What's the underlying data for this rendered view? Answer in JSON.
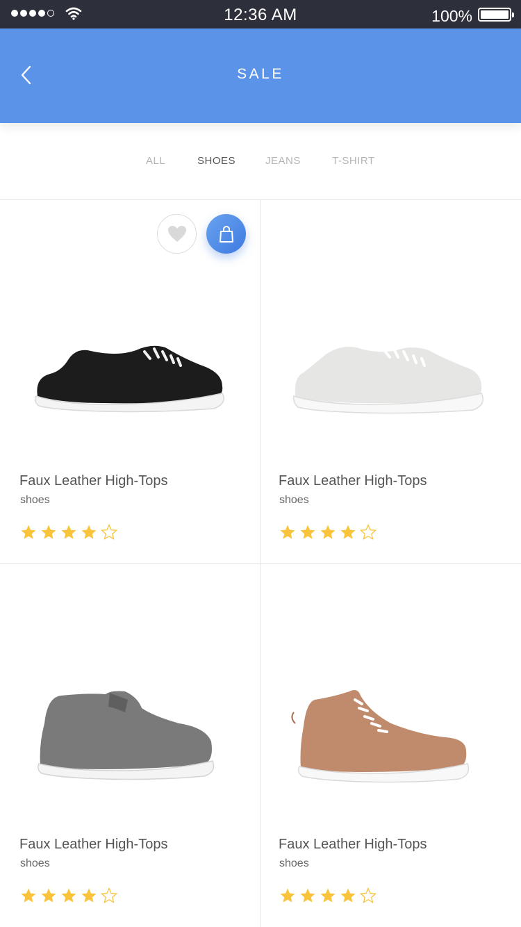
{
  "status_bar": {
    "time": "12:36 AM",
    "battery": "100%"
  },
  "header": {
    "title": "SALE"
  },
  "tabs": [
    {
      "label": "ALL",
      "active": false
    },
    {
      "label": "SHOES",
      "active": true
    },
    {
      "label": "JEANS",
      "active": false
    },
    {
      "label": "T-SHIRT",
      "active": false
    }
  ],
  "products": [
    {
      "name": "Faux Leather High-Tops",
      "category": "shoes",
      "rating": 4,
      "max_rating": 5,
      "color": "#1c1c1c"
    },
    {
      "name": "Faux Leather High-Tops",
      "category": "shoes",
      "rating": 4,
      "max_rating": 5,
      "color": "#e6e6e4"
    },
    {
      "name": "Faux Leather High-Tops",
      "category": "shoes",
      "rating": 4,
      "max_rating": 5,
      "color": "#7a7a7a"
    },
    {
      "name": "Faux Leather High-Tops",
      "category": "shoes",
      "rating": 4,
      "max_rating": 5,
      "color": "#c08a6c"
    }
  ],
  "colors": {
    "accent": "#5b93e8",
    "star": "#f9c33c",
    "status_bar": "#2d2f3a"
  },
  "icons": {
    "back": "chevron-left-icon",
    "favorite": "heart-icon",
    "cart": "shopping-bag-icon",
    "star": "star-icon"
  }
}
